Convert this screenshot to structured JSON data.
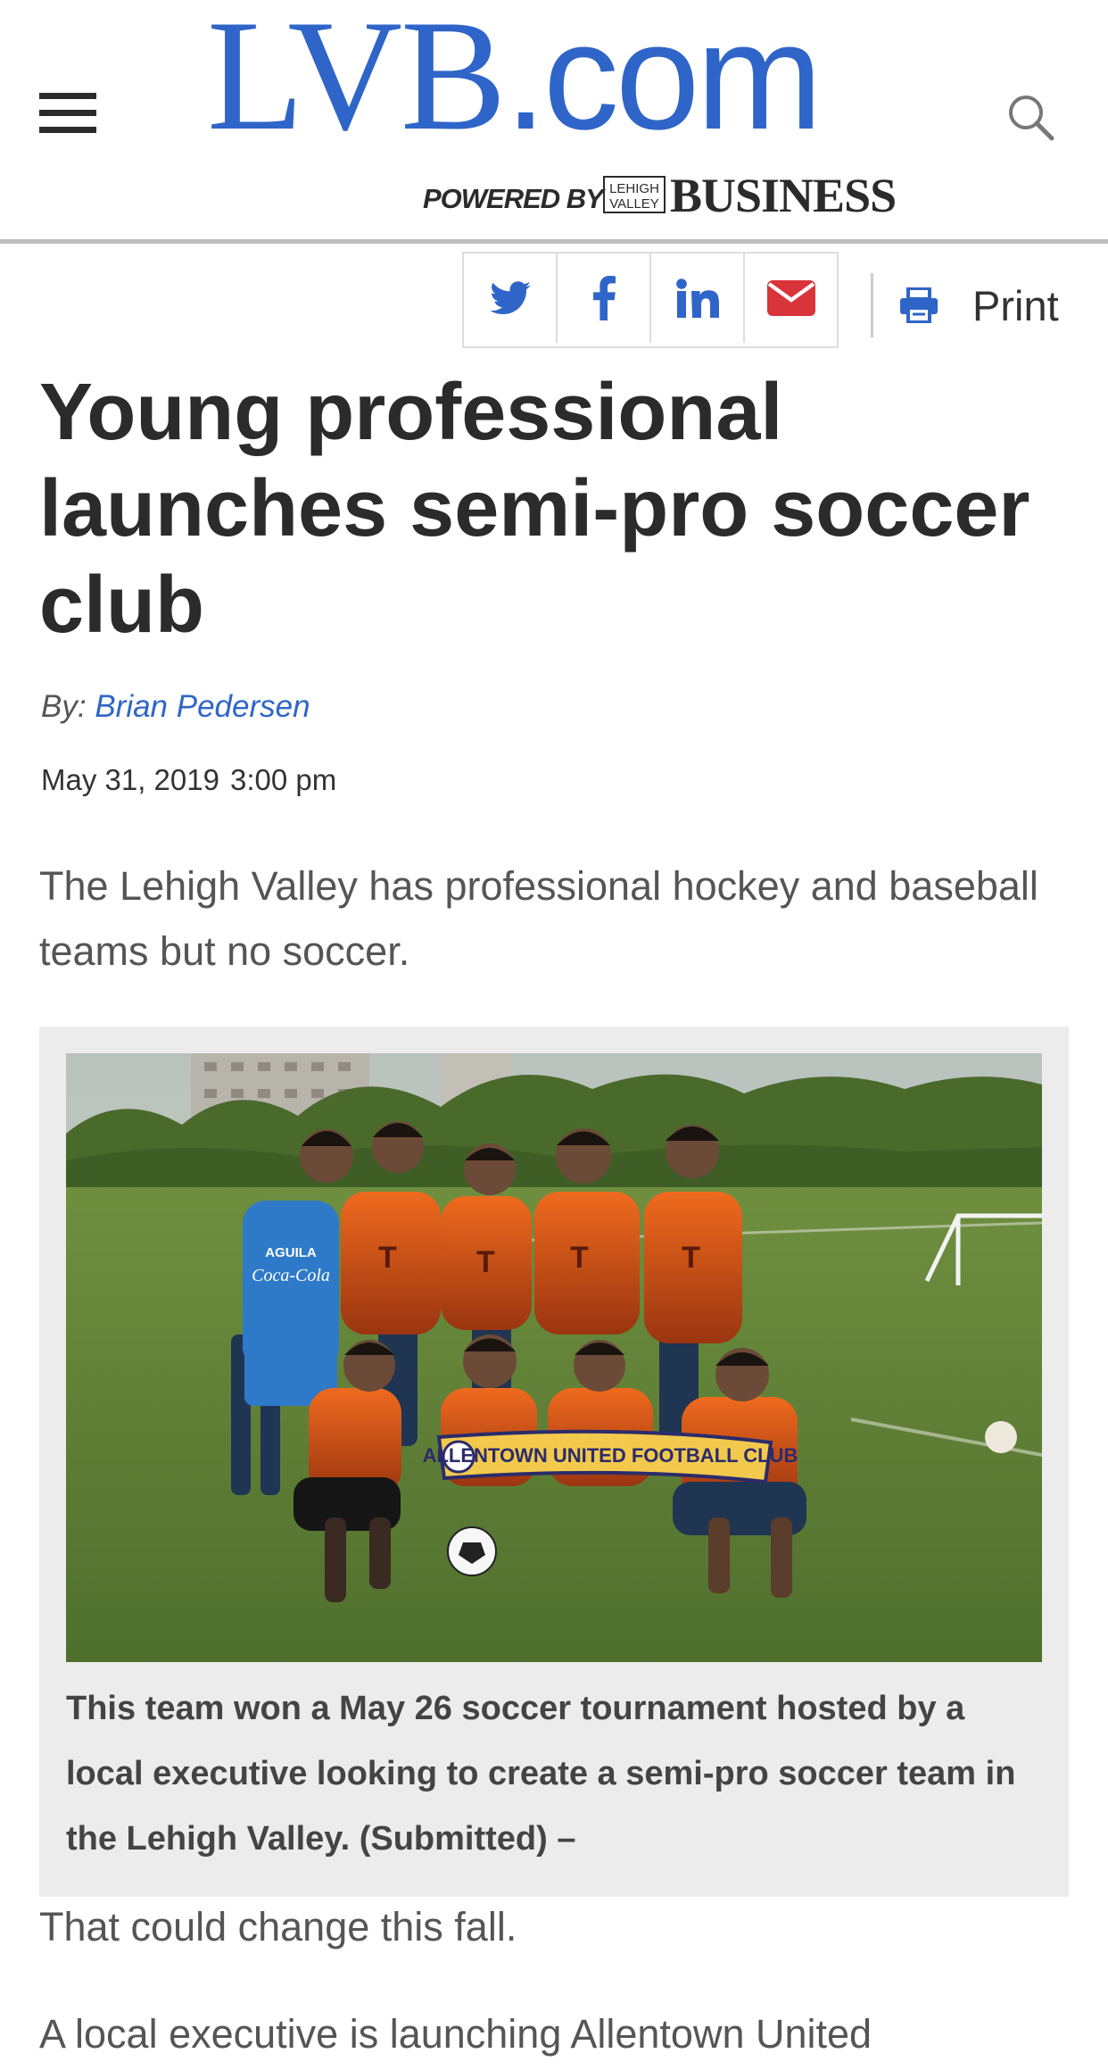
{
  "header": {
    "logo_main": "LVB",
    "logo_suffix": ".com",
    "powered_by": "POWERED BY",
    "lehigh_valley_mark": "LEHIGH VALLEY",
    "business": "BUSINESS",
    "brand_color": "#2f65c8"
  },
  "share": {
    "buttons": [
      {
        "icon": "twitter-icon",
        "color": "#2f65c8"
      },
      {
        "icon": "facebook-icon",
        "color": "#2f65c8"
      },
      {
        "icon": "linkedin-icon",
        "color": "#2f65c8"
      },
      {
        "icon": "email-icon",
        "color": "#d9343a"
      }
    ],
    "print_label": "Print"
  },
  "article": {
    "headline": "Young professional launches semi-pro soccer club",
    "byline_prefix": "By:",
    "author": "Brian Pedersen",
    "date": "May 31, 2019",
    "time": "3:00 pm",
    "lead": "The Lehigh Valley has professional hockey and baseball teams but no soccer.",
    "photo": {
      "banner_text": "ALLENTOWN UNITED FOOTBALL CLUB",
      "shirt_sponsor": "AGUILA",
      "caption": "This team won a May 26 soccer tournament hosted by a local executive looking to create a semi-pro soccer team in the Lehigh Valley. (Submitted) –"
    },
    "paragraphs": [
      "That could change this fall.",
      "A local executive is launching Allentown United"
    ]
  }
}
